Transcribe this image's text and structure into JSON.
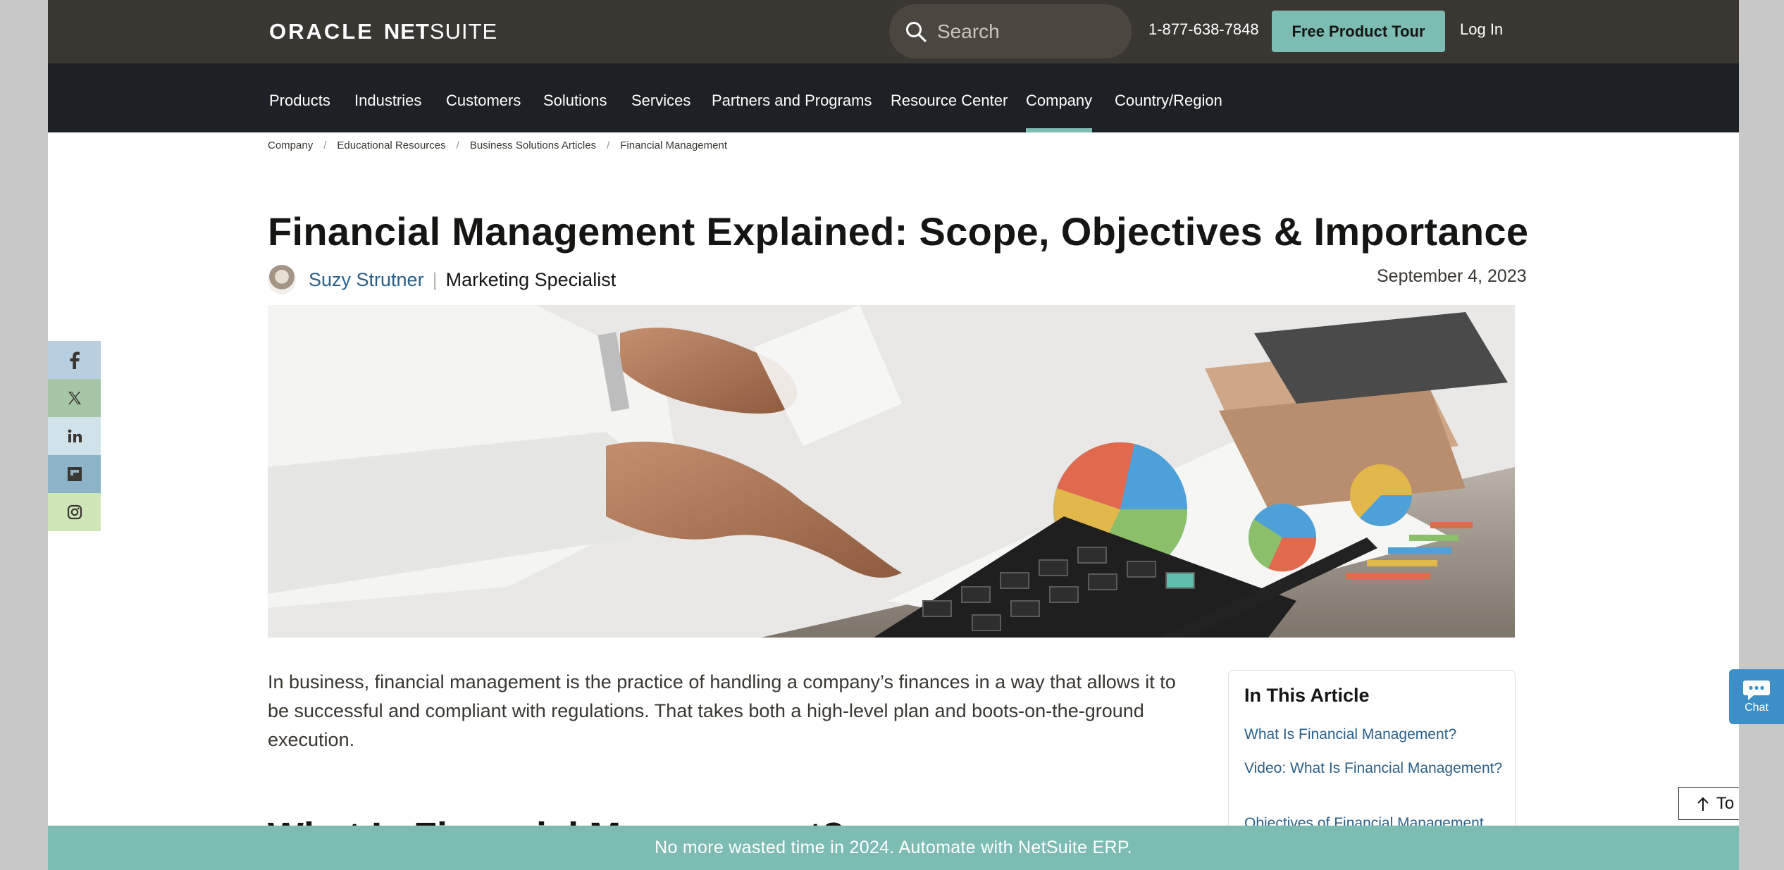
{
  "header": {
    "logo_oracle": "ORACLE",
    "logo_net": "NET",
    "logo_suite": "SUITE",
    "search_placeholder": "Search",
    "phone": "1-877-638-7848",
    "tour_label": "Free Product Tour",
    "login_label": "Log In"
  },
  "nav": {
    "items": [
      "Products",
      "Industries",
      "Customers",
      "Solutions",
      "Services",
      "Partners and Programs",
      "Resource Center",
      "Company",
      "Country/Region"
    ],
    "active": "Company"
  },
  "breadcrumb": [
    "Company",
    "Educational Resources",
    "Business Solutions Articles",
    "Financial Management"
  ],
  "article": {
    "title": "Financial Management Explained: Scope, Objectives & Importance",
    "author_name": "Suzy Strutner",
    "author_sep": "|",
    "author_role": "Marketing Specialist",
    "date": "September 4, 2023",
    "intro": "In business, financial management is the practice of handling a company’s finances in a way that allows it to be successful and compliant with regulations. That takes both a high-level plan and boots-on-the-ground execution.",
    "next_heading_partial": "What Is Financial Management?"
  },
  "toc": {
    "heading": "In This Article",
    "links": [
      "What Is Financial Management?",
      "Video: What Is Financial Management?",
      "Objectives of Financial Management"
    ]
  },
  "social": [
    "facebook-icon",
    "x-icon",
    "linkedin-icon",
    "flipboard-icon",
    "instagram-icon"
  ],
  "widgets": {
    "chat_label": "Chat",
    "to_top_label": "To Top"
  },
  "promo_banner": "No more wasted time in 2024. Automate with NetSuite ERP.",
  "colors": {
    "topbar": "#3a3631",
    "navbar": "#1d2024",
    "accent_teal": "#7cbcb3",
    "link_blue": "#2b5f87",
    "chat_blue": "#3d8fc7"
  }
}
